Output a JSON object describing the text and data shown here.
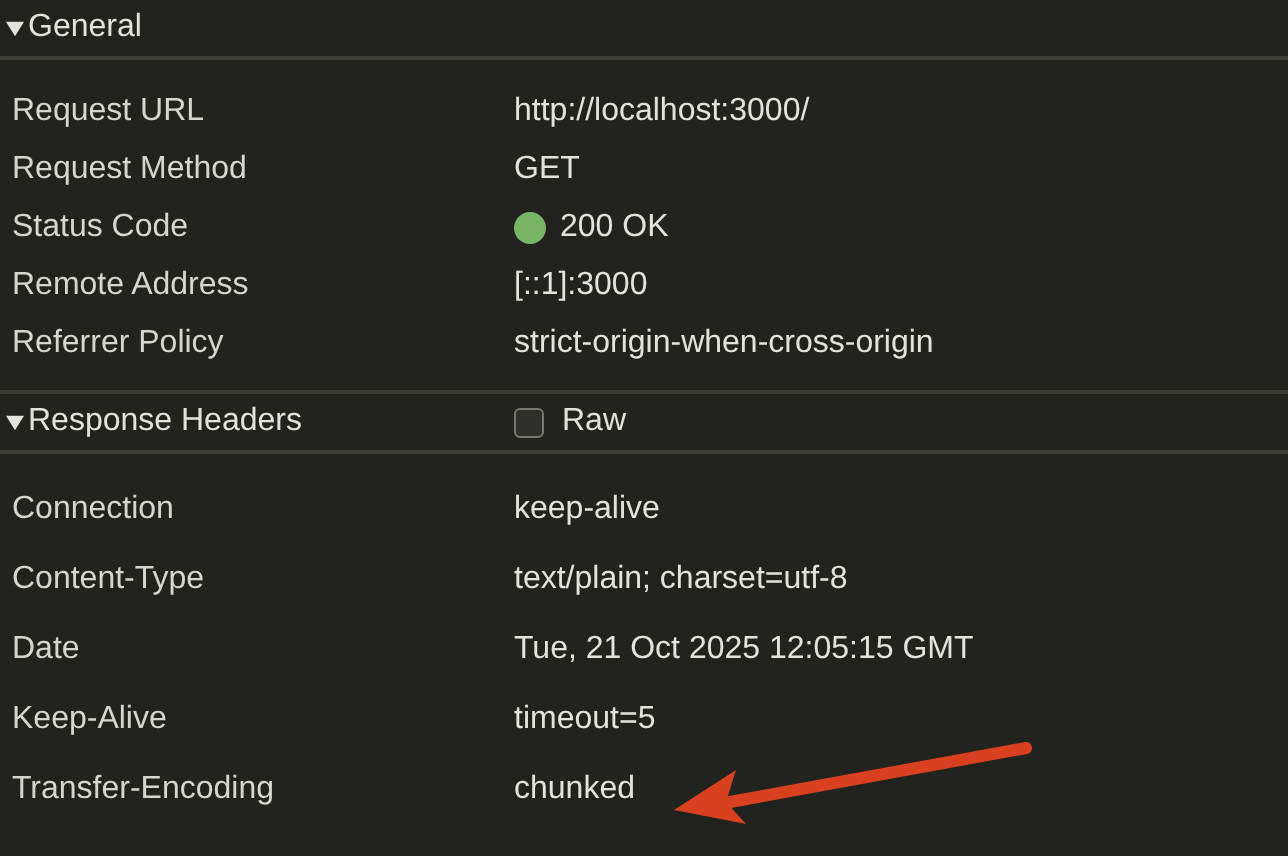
{
  "sections": [
    {
      "title": "General",
      "expanded": true,
      "rows": [
        {
          "kind": "text",
          "name": "Request URL",
          "value": "http://localhost:3000/"
        },
        {
          "kind": "text",
          "name": "Request Method",
          "value": "GET"
        },
        {
          "kind": "status",
          "name": "Status Code",
          "value": "200 OK",
          "color": "#7ab466"
        },
        {
          "kind": "text",
          "name": "Remote Address",
          "value": "[::1]:3000"
        },
        {
          "kind": "text",
          "name": "Referrer Policy",
          "value": "strict-origin-when-cross-origin"
        }
      ]
    },
    {
      "title": "Response Headers",
      "expanded": true,
      "raw": {
        "label": "Raw",
        "checked": false
      },
      "rows": [
        {
          "kind": "text",
          "name": "Connection",
          "value": "keep-alive"
        },
        {
          "kind": "text",
          "name": "Content-Type",
          "value": "text/plain; charset=utf-8"
        },
        {
          "kind": "text",
          "name": "Date",
          "value": "Tue, 21 Oct 2025 12:05:15 GMT"
        },
        {
          "kind": "text",
          "name": "Keep-Alive",
          "value": "timeout=5"
        },
        {
          "kind": "text",
          "name": "Transfer-Encoding",
          "value": "chunked"
        }
      ]
    }
  ]
}
